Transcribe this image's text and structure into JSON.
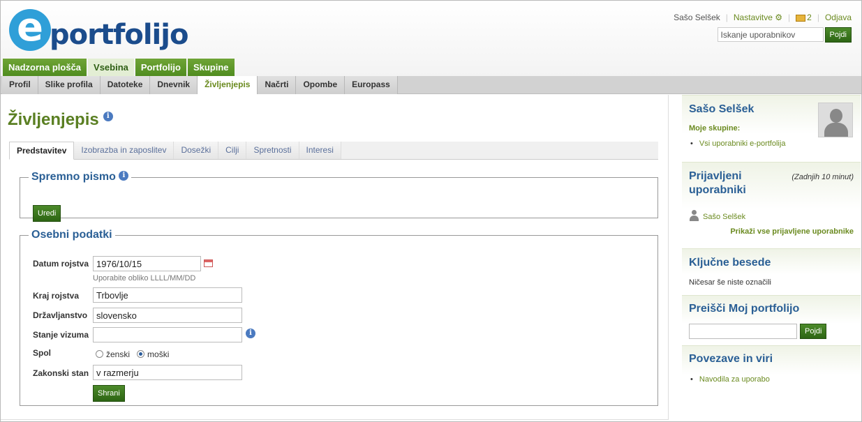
{
  "header": {
    "logo_e": "e",
    "logo_text": "portfolijo",
    "user_name": "Sašo Selšek",
    "settings_label": "Nastavitve",
    "messages_count": "2",
    "logout_label": "Odjava",
    "search_placeholder": "Iskanje uporabnikov",
    "search_button": "Pojdi"
  },
  "main_tabs": [
    "Nadzorna plošča",
    "Vsebina",
    "Portfolijo",
    "Skupine"
  ],
  "sub_tabs": [
    "Profil",
    "Slike profila",
    "Datoteke",
    "Dnevnik",
    "Življenjepis",
    "Načrti",
    "Opombe",
    "Europass"
  ],
  "page": {
    "title": "Življenjepis",
    "info_icon": "i",
    "tabs": [
      "Predstavitev",
      "Izobrazba in zaposlitev",
      "Dosežki",
      "Cilji",
      "Spretnosti",
      "Interesi"
    ],
    "cover_letter": {
      "legend": "Spremno pismo",
      "edit_button": "Uredi"
    },
    "personal": {
      "legend": "Osebni podatki",
      "dob_label": "Datum rojstva",
      "dob_value": "1976/10/15",
      "dob_hint": "Uporabite obliko LLLL/MM/DD",
      "birthplace_label": "Kraj rojstva",
      "birthplace_value": "Trbovlje",
      "citizenship_label": "Državljanstvo",
      "citizenship_value": "slovensko",
      "visa_label": "Stanje vizuma",
      "visa_value": "",
      "gender_label": "Spol",
      "gender_female": "ženski",
      "gender_male": "moški",
      "marital_label": "Zakonski stan",
      "marital_value": "v razmerju",
      "save_button": "Shrani"
    }
  },
  "sidebar": {
    "profile": {
      "name": "Sašo Selšek",
      "groups_label": "Moje skupine:",
      "group_item": "Vsi uporabniki e-portfolija"
    },
    "online": {
      "title_line1": "Prijavljeni",
      "title_line2": "uporabniki",
      "period": "(Zadnjih 10 minut)",
      "user": "Sašo Selšek",
      "show_all": "Prikaži vse prijavljene uporabnike"
    },
    "tags": {
      "title": "Ključne besede",
      "empty": "Ničesar še niste označili"
    },
    "search": {
      "title": "Preišči Moj portfolijo",
      "button": "Pojdi"
    },
    "links": {
      "title": "Povezave in viri",
      "item": "Navodila za uporabo"
    }
  }
}
